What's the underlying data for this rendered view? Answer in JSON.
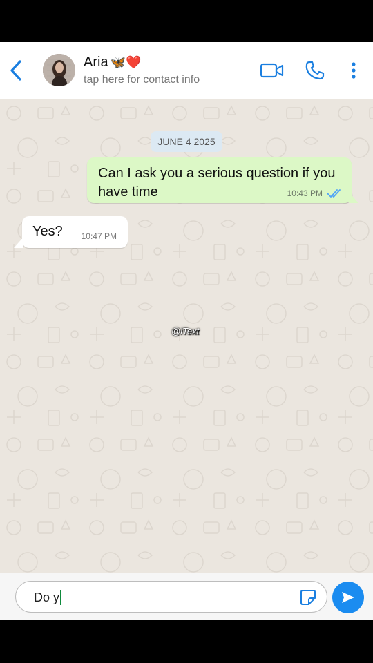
{
  "contact": {
    "name": "Aria",
    "emoji": "🦋❤️",
    "subtitle": "tap here for contact info"
  },
  "header_icons": [
    "back-chevron-icon",
    "video-call-icon",
    "phone-icon",
    "more-vertical-icon"
  ],
  "conversation": {
    "date_chip": "JUNE 4 2025",
    "messages": [
      {
        "direction": "outgoing",
        "text": "Can I ask you a serious question if you have time",
        "time": "10:43 PM",
        "status": "read"
      },
      {
        "direction": "incoming",
        "text": "Yes?",
        "time": "10:47 PM"
      }
    ]
  },
  "watermark": "@iText",
  "composer": {
    "value": "Do y"
  },
  "colors": {
    "accent": "#1b8cf0",
    "outgoing_bubble": "#dcf8c6",
    "incoming_bubble": "#ffffff",
    "chat_background": "#ebe6df",
    "date_chip": "#dce9f3"
  }
}
